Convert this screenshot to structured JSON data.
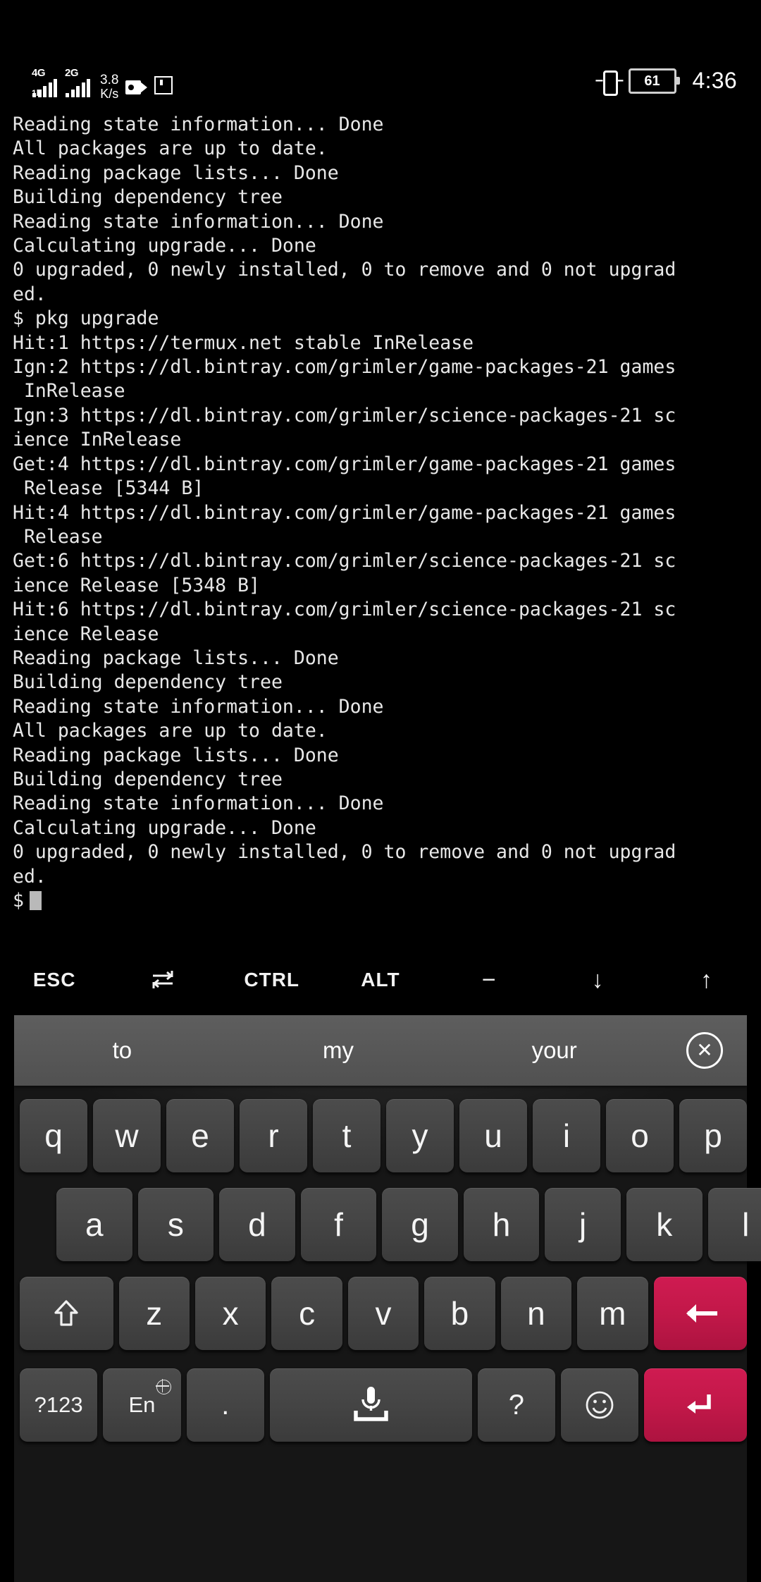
{
  "statusbar": {
    "signal_1": {
      "generation": "4G",
      "prefix": "1b",
      "icon": "signal-bars-icon"
    },
    "signal_2": {
      "generation": "2G",
      "prefix": "",
      "icon": "signal-bars-icon"
    },
    "data_rate": {
      "value": "3.8",
      "unit": "K/s"
    },
    "icons": [
      "video-recording-icon",
      "screenshot-square-icon",
      "vibrate-icon"
    ],
    "battery": {
      "level": "61",
      "icon": "battery-icon"
    },
    "time": "4:36"
  },
  "terminal": {
    "lines": [
      "Reading state information... Done",
      "All packages are up to date.",
      "Reading package lists... Done",
      "Building dependency tree",
      "Reading state information... Done",
      "Calculating upgrade... Done",
      "0 upgraded, 0 newly installed, 0 to remove and 0 not upgrad",
      "ed.",
      "$ pkg upgrade",
      "Hit:1 https://termux.net stable InRelease",
      "Ign:2 https://dl.bintray.com/grimler/game-packages-21 games",
      " InRelease",
      "Ign:3 https://dl.bintray.com/grimler/science-packages-21 sc",
      "ience InRelease",
      "Get:4 https://dl.bintray.com/grimler/game-packages-21 games",
      " Release [5344 B]",
      "Hit:4 https://dl.bintray.com/grimler/game-packages-21 games",
      " Release",
      "Get:6 https://dl.bintray.com/grimler/science-packages-21 sc",
      "ience Release [5348 B]",
      "Hit:6 https://dl.bintray.com/grimler/science-packages-21 sc",
      "ience Release",
      "Reading package lists... Done",
      "Building dependency tree",
      "Reading state information... Done",
      "All packages are up to date.",
      "Reading package lists... Done",
      "Building dependency tree",
      "Reading state information... Done",
      "Calculating upgrade... Done",
      "0 upgraded, 0 newly installed, 0 to remove and 0 not upgrad",
      "ed."
    ],
    "prompt_symbol": "$",
    "foreground_color": "#e8e8e8",
    "background_color": "#000000"
  },
  "extra_keys": [
    {
      "label": "ESC",
      "name": "esc"
    },
    {
      "label": "",
      "name": "tab",
      "icon": "tab-arrows-icon"
    },
    {
      "label": "CTRL",
      "name": "ctrl"
    },
    {
      "label": "ALT",
      "name": "alt"
    },
    {
      "label": "−",
      "name": "minus"
    },
    {
      "label": "↓",
      "name": "arrow-down"
    },
    {
      "label": "↑",
      "name": "arrow-up"
    }
  ],
  "keyboard": {
    "accent_color": "#c21849",
    "key_color": "#454545",
    "suggestions": [
      "to",
      "my",
      "your"
    ],
    "suggestion_close_icon": "close-circle-icon",
    "rows": {
      "row1": [
        "q",
        "w",
        "e",
        "r",
        "t",
        "y",
        "u",
        "i",
        "o",
        "p"
      ],
      "row2": [
        "a",
        "s",
        "d",
        "f",
        "g",
        "h",
        "j",
        "k",
        "l"
      ],
      "row3_shift": "shift-icon",
      "row3": [
        "z",
        "x",
        "c",
        "v",
        "b",
        "n",
        "m"
      ],
      "row3_backspace": "backspace-icon",
      "row4": {
        "symbols": "?123",
        "language": "En",
        "language_icon": "globe-icon",
        "period": ".",
        "space_icon": "microphone-space-icon",
        "question": "?",
        "emoji_icon": "smiley-icon",
        "enter_icon": "enter-icon"
      }
    }
  }
}
